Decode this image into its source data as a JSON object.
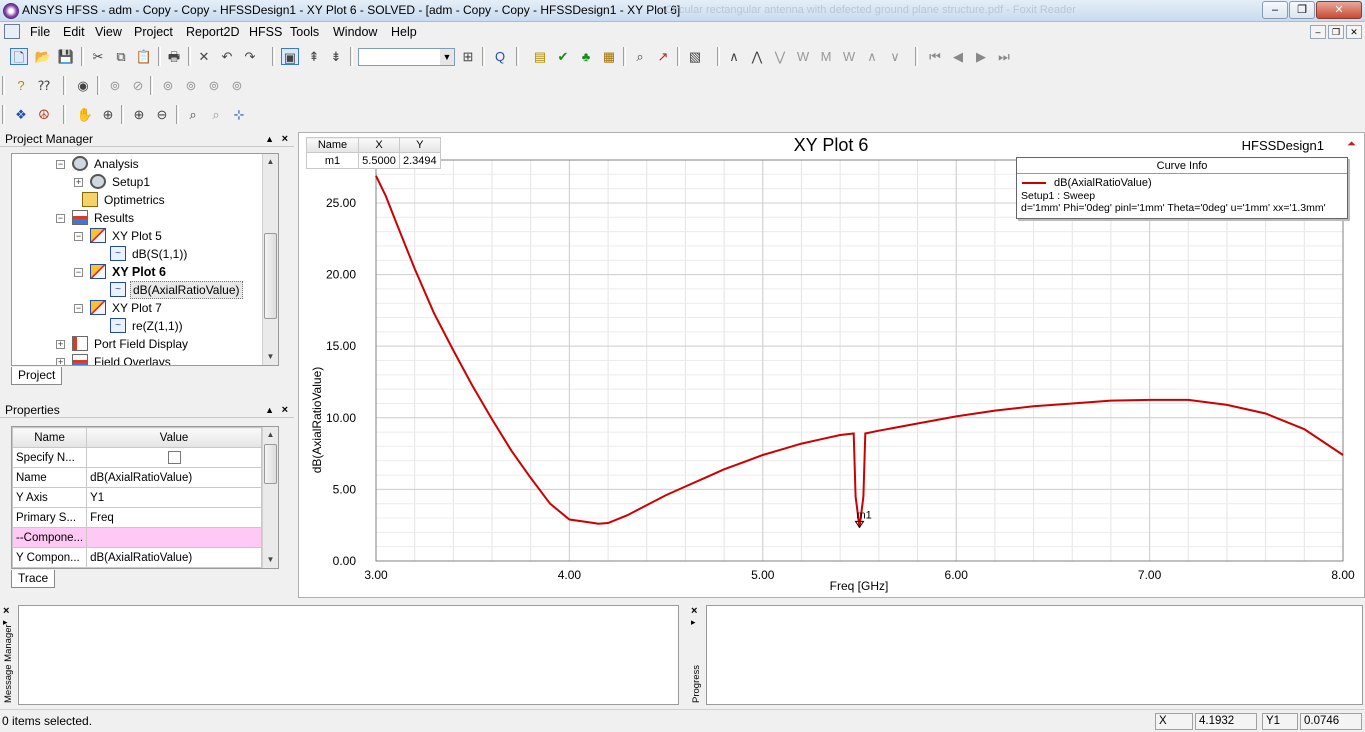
{
  "window": {
    "title": "ANSYS HFSS - adm - Copy - Copy - HFSSDesign1 - XY Plot 6 - SOLVED - [adm - Copy - Copy - HFSSDesign1 - XY Plot 6]",
    "background_title": "Circular rectangular antenna with defected ground plane structure.pdf - Foxit Reader",
    "minimize": "–",
    "maximize": "❐",
    "close": "✕"
  },
  "menu": [
    "File",
    "Edit",
    "View",
    "Project",
    "Report2D",
    "HFSS",
    "Tools",
    "Window",
    "Help"
  ],
  "mdi_buttons": [
    "–",
    "❐",
    "✕"
  ],
  "toolbar": {
    "combo_value": ""
  },
  "project_manager": {
    "title": "Project Manager",
    "pin": "▲",
    "close": "×",
    "tree": [
      {
        "label": "Analysis",
        "expander": "−",
        "icon": "gear"
      },
      {
        "label": "Setup1",
        "expander": "+",
        "icon": "gear"
      },
      {
        "label": "Optimetrics",
        "expander": "",
        "icon": "opt"
      },
      {
        "label": "Results",
        "expander": "−",
        "icon": "res"
      },
      {
        "label": "XY Plot 5",
        "expander": "−",
        "icon": "plot"
      },
      {
        "label": "dB(S(1,1))",
        "expander": "",
        "icon": "trace"
      },
      {
        "label": "XY Plot 6",
        "expander": "−",
        "icon": "plot",
        "bold": true
      },
      {
        "label": "dB(AxialRatioValue)",
        "expander": "",
        "icon": "trace",
        "selected": true
      },
      {
        "label": "XY Plot 7",
        "expander": "−",
        "icon": "plot"
      },
      {
        "label": "re(Z(1,1))",
        "expander": "",
        "icon": "trace"
      },
      {
        "label": "Port Field Display",
        "expander": "+",
        "icon": "port"
      },
      {
        "label": "Field Overlays",
        "expander": "+",
        "icon": "res"
      }
    ],
    "tab": "Project"
  },
  "properties": {
    "title": "Properties",
    "pin": "▲",
    "close": "×",
    "headers": [
      "Name",
      "Value"
    ],
    "rows": [
      {
        "name": "Specify N...",
        "value": "",
        "checkbox": true
      },
      {
        "name": "Name",
        "value": "dB(AxialRatioValue)"
      },
      {
        "name": "Y Axis",
        "value": "Y1"
      },
      {
        "name": "Primary S...",
        "value": "Freq"
      },
      {
        "name": "--Compone...",
        "value": "",
        "highlight": true
      },
      {
        "name": "Y Compon...",
        "value": "dB(AxialRatioValue)"
      }
    ],
    "tab": "Trace"
  },
  "plot": {
    "design_name": "HFSSDesign1",
    "marker_table": {
      "headers": [
        "Name",
        "X",
        "Y"
      ],
      "rows": [
        [
          "m1",
          "5.5000",
          "2.3494"
        ]
      ]
    },
    "curve_info": {
      "title": "Curve Info",
      "legend": "dB(AxialRatioValue)",
      "line1": "Setup1 : Sweep",
      "line2": "d='1mm' Phi='0deg' pinl='1mm' Theta='0deg' u='1mm' xx='1.3mm'"
    },
    "marker_label": "m1",
    "colors": {
      "trace": "#cc0000",
      "grid": "#d9d9d9"
    }
  },
  "chart_data": {
    "type": "line",
    "title": "XY Plot 6",
    "xlabel": "Freq [GHz]",
    "ylabel": "dB(AxialRatioValue)",
    "xlim": [
      3.0,
      8.0
    ],
    "ylim": [
      0.0,
      28.0
    ],
    "xticks": [
      3.0,
      4.0,
      5.0,
      6.0,
      7.0,
      8.0
    ],
    "xtick_labels": [
      "3.00",
      "4.00",
      "5.00",
      "6.00",
      "7.00",
      "8.00"
    ],
    "yticks": [
      0,
      5,
      10,
      15,
      20,
      25
    ],
    "ytick_labels": [
      "0.00",
      "5.00",
      "10.00",
      "15.00",
      "20.00",
      "25.00"
    ],
    "grid": true,
    "series": [
      {
        "name": "dB(AxialRatioValue)",
        "x": [
          3.0,
          3.05,
          3.1,
          3.2,
          3.3,
          3.4,
          3.5,
          3.6,
          3.7,
          3.8,
          3.9,
          4.0,
          4.1,
          4.15,
          4.2,
          4.3,
          4.4,
          4.5,
          4.6,
          4.7,
          4.8,
          4.9,
          5.0,
          5.1,
          5.2,
          5.3,
          5.4,
          5.47,
          5.48,
          5.5,
          5.52,
          5.53,
          5.6,
          5.8,
          6.0,
          6.2,
          6.4,
          6.6,
          6.8,
          7.0,
          7.2,
          7.4,
          7.6,
          7.8,
          8.0
        ],
        "y": [
          26.9,
          25.5,
          23.8,
          20.4,
          17.3,
          14.7,
          12.2,
          9.9,
          7.7,
          5.8,
          4.0,
          2.9,
          2.7,
          2.6,
          2.65,
          3.2,
          3.9,
          4.6,
          5.2,
          5.8,
          6.4,
          6.9,
          7.4,
          7.8,
          8.2,
          8.5,
          8.8,
          8.9,
          4.5,
          2.35,
          4.5,
          8.9,
          9.1,
          9.6,
          10.1,
          10.5,
          10.8,
          11.0,
          11.2,
          11.25,
          11.25,
          10.9,
          10.3,
          9.2,
          7.4
        ]
      }
    ],
    "markers": [
      {
        "name": "m1",
        "x": 5.5,
        "y": 2.3494
      }
    ]
  },
  "bottom": {
    "message_manager": "Message Manager",
    "progress": "Progress",
    "close": "×",
    "pin": "▸"
  },
  "status": {
    "text": "0 items selected.",
    "x_label": "X",
    "x_value": "4.1932",
    "y_label": "Y1",
    "y_value": "0.0746"
  }
}
